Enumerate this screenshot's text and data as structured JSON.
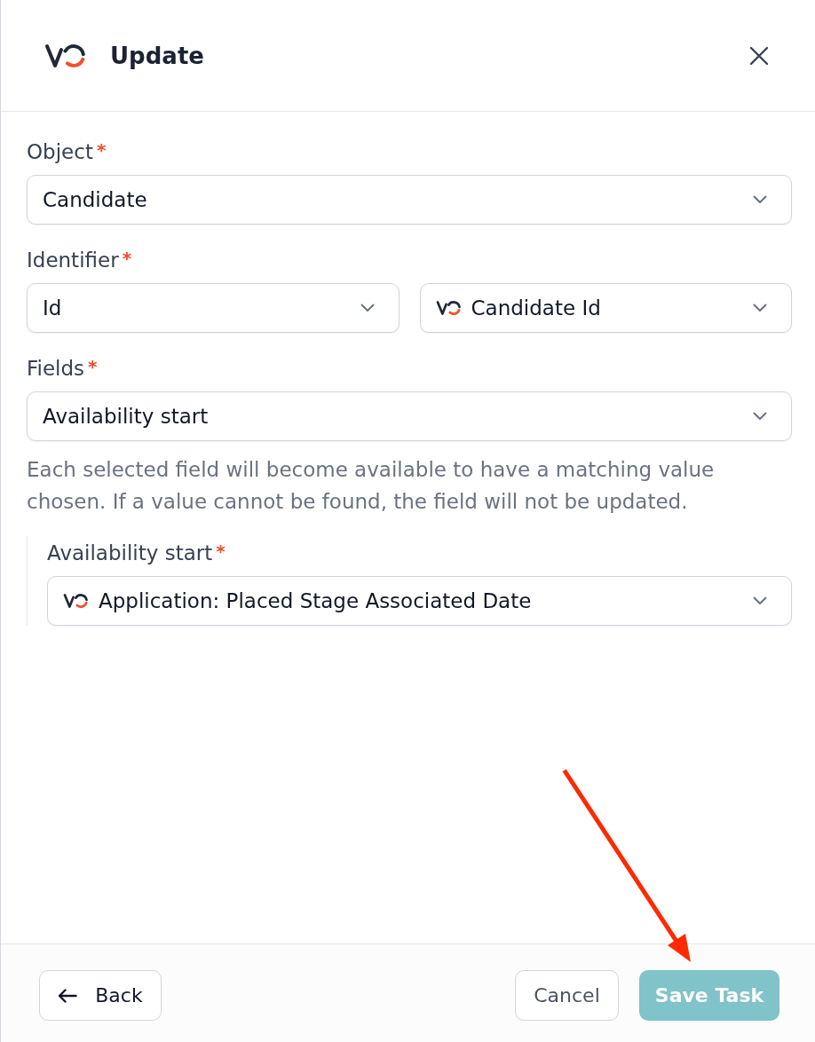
{
  "header": {
    "title": "Update"
  },
  "groups": [
    {
      "label": "Object",
      "required_mark": "*",
      "dropdowns": [
        {
          "kind": "plain",
          "value": "Candidate"
        }
      ]
    },
    {
      "label": "Identifier",
      "required_mark": "*",
      "dropdowns": [
        {
          "kind": "plain",
          "value": "Id"
        },
        {
          "kind": "linked",
          "value": "Candidate Id"
        }
      ]
    },
    {
      "label": "Fields",
      "required_mark": "*",
      "dropdowns": [
        {
          "kind": "plain",
          "value": "Availability start"
        }
      ],
      "help": "Each selected field will become available to have a matching value chosen. If a value cannot be found, the field will not be updated."
    }
  ],
  "mappings": [
    {
      "label": "Availability start",
      "required_mark": "*",
      "dropdown": {
        "kind": "linked",
        "value": "Application: Placed Stage Associated Date"
      }
    }
  ],
  "footer": {
    "back": "Back",
    "cancel": "Cancel",
    "save": {
      "label": "Save Task",
      "disabled": true
    }
  },
  "annotations": [
    {
      "kind": "arrow"
    }
  ]
}
